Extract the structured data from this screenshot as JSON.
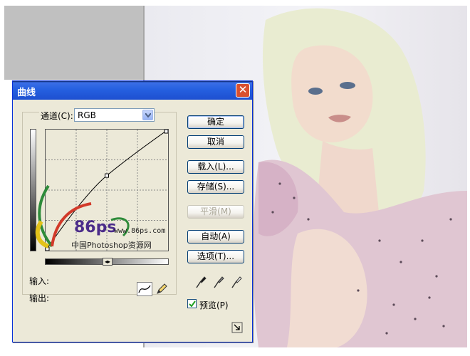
{
  "dialog": {
    "title": "曲线",
    "close_glyph": "✕",
    "channel_label": "通道(C):",
    "channel_value": "RGB",
    "input_label": "输入:",
    "output_label": "输出:",
    "swap_glyph": "◂▸",
    "buttons": {
      "ok": "确定",
      "cancel": "取消",
      "load": "载入(L)...",
      "save": "存储(S)...",
      "smooth": "平滑(M)",
      "auto": "自动(A)",
      "options": "选项(T)..."
    },
    "preview_label": "预览(P)",
    "preview_checked": true,
    "curve_points": [
      [
        0,
        0
      ],
      [
        0.5,
        0.62
      ],
      [
        1,
        1
      ]
    ]
  },
  "watermark": {
    "brand": "86ps",
    "url": "www.86ps.com",
    "caption": "中国Photoshop资源网"
  },
  "icons": {
    "dropdown": "chevron-down-icon",
    "curve_tool": "curve-tool-icon",
    "pencil_tool": "pencil-icon",
    "eyedroppers": [
      "black-eyedropper-icon",
      "gray-eyedropper-icon",
      "white-eyedropper-icon"
    ],
    "expand": "expand-icon"
  },
  "colors": {
    "title_bar": "#2560e0",
    "dialog_bg": "#ece9d8",
    "close_button": "#d9502f"
  }
}
